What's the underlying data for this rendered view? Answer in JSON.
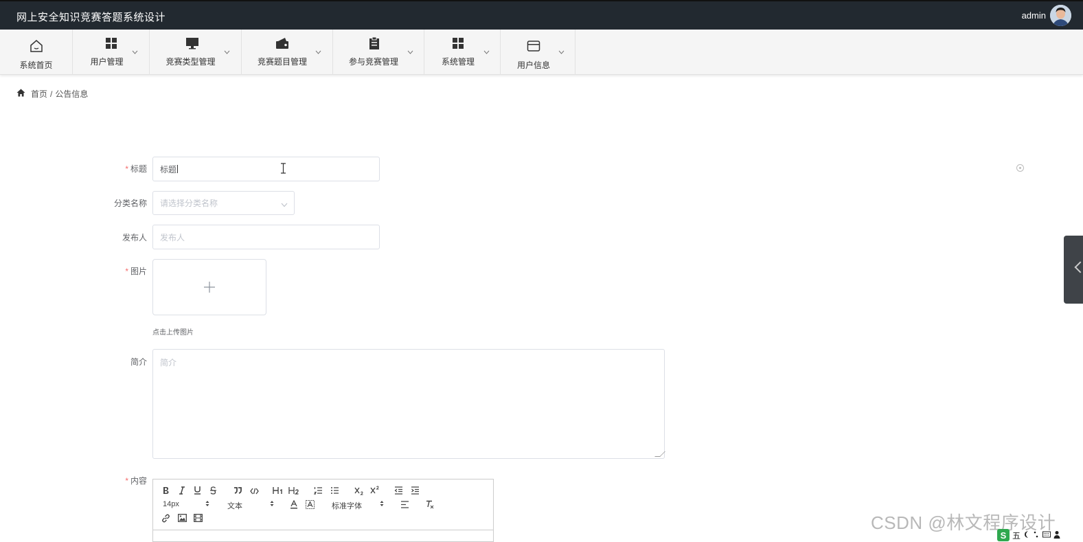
{
  "header": {
    "app_title": "网上安全知识竞赛答题系统设计",
    "user_name": "admin"
  },
  "nav": {
    "items": [
      {
        "label": "系统首页",
        "icon": "home-icon"
      },
      {
        "label": "用户管理",
        "icon": "grid-icon"
      },
      {
        "label": "竞赛类型管理",
        "icon": "monitor-icon"
      },
      {
        "label": "竞赛题目管理",
        "icon": "wallet-icon"
      },
      {
        "label": "参与竞赛管理",
        "icon": "clipboard-icon"
      },
      {
        "label": "系统管理",
        "icon": "grid-icon"
      },
      {
        "label": "用户信息",
        "icon": "card-icon"
      }
    ]
  },
  "breadcrumb": {
    "home": "首页",
    "separator": "/",
    "current": "公告信息"
  },
  "form": {
    "title_label": "标题",
    "title_value": "标题",
    "category_label": "分类名称",
    "category_placeholder": "请选择分类名称",
    "publisher_label": "发布人",
    "publisher_placeholder": "发布人",
    "image_label": "图片",
    "upload_hint": "点击上传图片",
    "intro_label": "简介",
    "intro_placeholder": "简介",
    "content_label": "内容"
  },
  "editor": {
    "font_size": "14px",
    "text_style": "文本",
    "font_family": "标准字体"
  },
  "watermark": "CSDN @林文程序设计",
  "ime": {
    "label": "五"
  },
  "colors": {
    "topbar": "#222930",
    "navbar": "#f5f5f5",
    "required": "#f56c6c",
    "border": "#dcdfe6"
  }
}
